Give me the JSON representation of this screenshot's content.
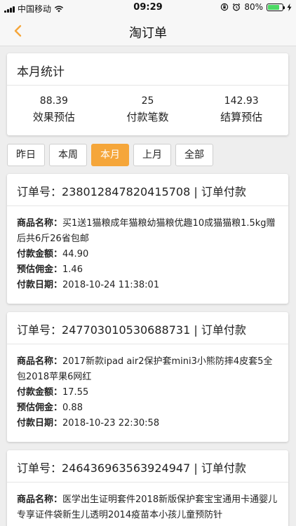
{
  "status_bar": {
    "carrier": "中国移动",
    "time": "09:29",
    "battery_text": "80%",
    "battery_level": 0.8
  },
  "nav": {
    "title": "淘订单"
  },
  "stats": {
    "title": "本月统计",
    "items": [
      {
        "value": "88.39",
        "label": "效果预估"
      },
      {
        "value": "25",
        "label": "付款笔数"
      },
      {
        "value": "142.93",
        "label": "结算预估"
      }
    ]
  },
  "filters": [
    "昨日",
    "本周",
    "本月",
    "上月",
    "全部"
  ],
  "active_filter": "本月",
  "labels": {
    "order_no": "订单号：",
    "product": "商品名称：",
    "amount": "付款金额：",
    "commission": "预估佣金：",
    "date": "付款日期："
  },
  "orders": [
    {
      "number": "238012847820415708",
      "status": "订单付款",
      "product": "买1送1猫粮成年猫粮幼猫粮优趣10成猫猫粮1.5kg赠后共6斤26省包邮",
      "amount": "44.90",
      "commission": "1.46",
      "date": "2018-10-24 11:38:01"
    },
    {
      "number": "247703010530688731",
      "status": "订单付款",
      "product": "2017新款ipad air2保护套mini3小熊防摔4皮套5全包2018苹果6网红",
      "amount": "17.55",
      "commission": "0.88",
      "date": "2018-10-23 22:30:58"
    },
    {
      "number": "246436963563924947",
      "status": "订单付款",
      "product": "医学出生证明套件2018新版保护套宝宝通用卡通婴儿专享证件袋新生儿透明2014疫苗本小孩儿童预防针"
    }
  ],
  "colors": {
    "accent": "#f5a63a",
    "battery": "#4cd964"
  }
}
